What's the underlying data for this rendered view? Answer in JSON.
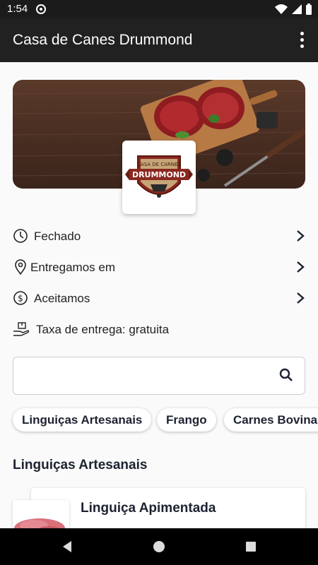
{
  "status_bar": {
    "time": "1:54"
  },
  "app_bar": {
    "title": "Casa de Canes Drummond"
  },
  "logo": {
    "line1": "CASA DE CARNES",
    "line2": "DRUMMOND"
  },
  "info": {
    "hours": "Fechado",
    "delivery_area": "Entregamos em",
    "payment": "Aceitamos",
    "delivery_fee": "Taxa de entrega: gratuita"
  },
  "search": {
    "value": "",
    "placeholder": ""
  },
  "categories": [
    "Linguiças Artesanais",
    "Frango",
    "Carnes Bovinas"
  ],
  "section": {
    "title": "Linguiças Artesanais"
  },
  "products": [
    {
      "name": "Linguiça Apimentada"
    }
  ],
  "colors": {
    "app_bar": "#212121",
    "status_bar": "#1b1b1b",
    "background": "#fafafa"
  }
}
